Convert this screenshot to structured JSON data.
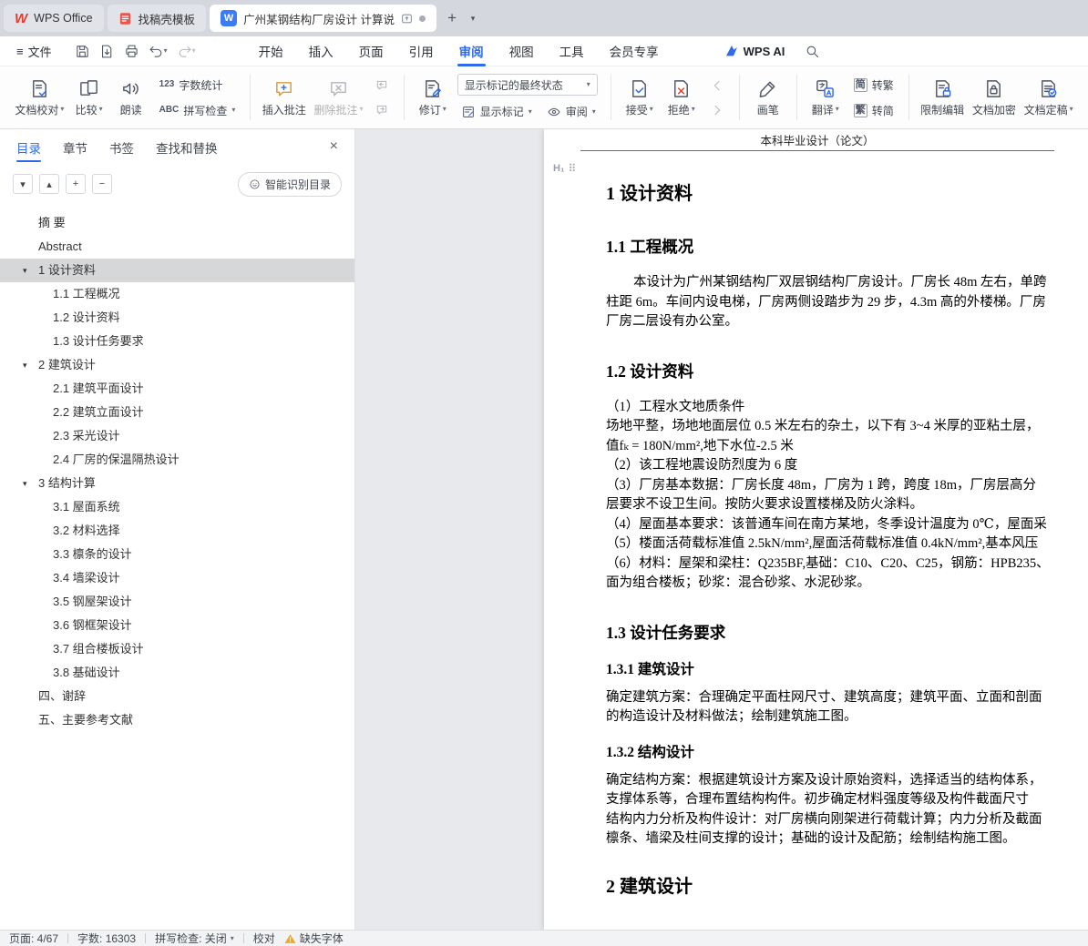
{
  "icons": {
    "caret_down": "▾",
    "chevron_down": "▾",
    "chevron_up": "▴",
    "plus": "+",
    "minus": "−",
    "close": "×",
    "hamburger": "≡",
    "dots_handle": "⠿",
    "h1_badge": "H₁",
    "new_tab": "+",
    "word_count_badge": "123",
    "spell_badge": "ABC",
    "wps_logo": "W",
    "word_logo": "W",
    "toc_arrow": "▾"
  },
  "tabbar": {
    "tabs": [
      {
        "label": "WPS Office"
      },
      {
        "label": "找稿壳模板"
      },
      {
        "label": "广州某钢结构厂房设计 计算说"
      }
    ]
  },
  "menubar": {
    "file_label": "文件",
    "tabs": [
      {
        "label": "开始"
      },
      {
        "label": "插入"
      },
      {
        "label": "页面"
      },
      {
        "label": "引用"
      },
      {
        "label": "审阅",
        "cls": "active"
      },
      {
        "label": "视图"
      },
      {
        "label": "工具"
      },
      {
        "label": "会员专享"
      }
    ],
    "wps_ai_label": "WPS AI"
  },
  "ribbon": {
    "proofread_label": "文档校对",
    "compare_label": "比较",
    "read_aloud_label": "朗读",
    "word_count_label": "字数统计",
    "spell_check_label": "拼写检查",
    "insert_comment_label": "插入批注",
    "delete_comment_label": "删除批注",
    "track_changes_label": "修订",
    "markup_state_value": "显示标记的最终状态",
    "show_markup_label": "显示标记",
    "review_label": "审阅",
    "accept_label": "接受",
    "reject_label": "拒绝",
    "pen_label": "画笔",
    "translate_label": "翻译",
    "to_trad_icon": "简",
    "to_trad_label": "转繁",
    "to_simp_icon": "繁",
    "to_simp_label": "转简",
    "restrict_label": "限制编辑",
    "encrypt_label": "文档加密",
    "finalize_label": "文档定稿"
  },
  "sidebar": {
    "panel_tabs": [
      {
        "label": "目录",
        "cls": "active"
      },
      {
        "label": "章节"
      },
      {
        "label": "书签"
      },
      {
        "label": "查找和替换"
      }
    ],
    "smart_toc_label": "智能识别目录",
    "toc_items": [
      {
        "label": "摘  要",
        "cls": "l0"
      },
      {
        "label": "Abstract",
        "cls": "l0"
      },
      {
        "label": "1 设计资料",
        "cls": "l0 exp sel"
      },
      {
        "label": "1.1 工程概况",
        "cls": "l1"
      },
      {
        "label": "1.2 设计资料",
        "cls": "l1"
      },
      {
        "label": "1.3 设计任务要求",
        "cls": "l1"
      },
      {
        "label": "2 建筑设计",
        "cls": "l0 exp"
      },
      {
        "label": "2.1 建筑平面设计",
        "cls": "l1"
      },
      {
        "label": "2.2 建筑立面设计",
        "cls": "l1"
      },
      {
        "label": "2.3 采光设计",
        "cls": "l1"
      },
      {
        "label": "2.4 厂房的保温隔热设计",
        "cls": "l1"
      },
      {
        "label": "3 结构计算",
        "cls": "l0 exp"
      },
      {
        "label": "3.1 屋面系统",
        "cls": "l1"
      },
      {
        "label": "3.2 材料选择",
        "cls": "l1"
      },
      {
        "label": "3.3 檩条的设计",
        "cls": "l1"
      },
      {
        "label": "3.4 墙梁设计",
        "cls": "l1"
      },
      {
        "label": "3.5 钢屋架设计",
        "cls": "l1"
      },
      {
        "label": "3.6 钢框架设计",
        "cls": "l1"
      },
      {
        "label": "3.7 组合楼板设计",
        "cls": "l1"
      },
      {
        "label": "3.8 基础设计",
        "cls": "l1"
      },
      {
        "label": "四、谢辞",
        "cls": "l0"
      },
      {
        "label": "五、主要参考文献",
        "cls": "l0"
      }
    ]
  },
  "document": {
    "page_header": "本科毕业设计（论文）",
    "blocks": [
      {
        "type": "h1",
        "text": "1 设计资料"
      },
      {
        "type": "h2",
        "text": "1.1 工程概况"
      },
      {
        "type": "p ind first",
        "text": "本设计为广州某钢结构厂双层钢结构厂房设计。厂房长 48m 左右，单跨"
      },
      {
        "type": "p",
        "text": "柱距 6m。车间内设电梯，厂房两侧设踏步为 29 步，4.3m 高的外楼梯。厂房"
      },
      {
        "type": "p",
        "text": "厂房二层设有办公室。"
      },
      {
        "type": "h2",
        "text": "1.2 设计资料"
      },
      {
        "type": "p first",
        "text": "（1）工程水文地质条件"
      },
      {
        "type": "p",
        "text": "场地平整，场地地面层位 0.5 米左右的杂土，以下有 3~4 米厚的亚粘土层，"
      },
      {
        "type": "p",
        "text": "值fₖ = 180N/mm²,地下水位-2.5 米"
      },
      {
        "type": "p",
        "text": "（2）该工程地震设防烈度为 6 度"
      },
      {
        "type": "p",
        "text": "（3）厂房基本数据：厂房长度 48m，厂房为 1 跨，跨度 18m，厂房层高分"
      },
      {
        "type": "p",
        "text": "层要求不设卫生间。按防火要求设置楼梯及防火涂料。"
      },
      {
        "type": "p",
        "text": "（4）屋面基本要求：该普通车间在南方某地，冬季设计温度为 0℃，屋面采"
      },
      {
        "type": "p",
        "text": "（5）楼面活荷载标准值 2.5kN/mm²,屋面活荷载标准值 0.4kN/mm²,基本风压"
      },
      {
        "type": "p",
        "text": "（6）材料：屋架和梁柱：Q235BF,基础：C10、C20、C25，钢筋：HPB235、"
      },
      {
        "type": "p",
        "text": "面为组合楼板；砂浆：混合砂浆、水泥砂浆。"
      },
      {
        "type": "h2",
        "text": "1.3 设计任务要求"
      },
      {
        "type": "h3",
        "text": "1.3.1 建筑设计"
      },
      {
        "type": "p tight",
        "text": "确定建筑方案：合理确定平面柱网尺寸、建筑高度；建筑平面、立面和剖面"
      },
      {
        "type": "p",
        "text": "的构造设计及材料做法；绘制建筑施工图。"
      },
      {
        "type": "h3",
        "text": "1.3.2 结构设计"
      },
      {
        "type": "p tight",
        "text": "确定结构方案：根据建筑设计方案及设计原始资料，选择适当的结构体系，"
      },
      {
        "type": "p",
        "text": "支撑体系等，合理布置结构构件。初步确定材料强度等级及构件截面尺寸"
      },
      {
        "type": "p",
        "text": "结构内力分析及构件设计：对厂房横向刚架进行荷载计算；内力分析及截面"
      },
      {
        "type": "p",
        "text": "檩条、墙梁及柱间支撑的设计；基础的设计及配筋；绘制结构施工图。"
      },
      {
        "type": "h1",
        "text": "2 建筑设计"
      },
      {
        "type": "h2",
        "text": "2.1 建筑平面设计"
      }
    ]
  },
  "statusbar": {
    "page": "页面: 4/67",
    "words": "字数: 16303",
    "spell": "拼写检查: 关闭",
    "proofread": "校对",
    "missing_font": "缺失字体"
  }
}
